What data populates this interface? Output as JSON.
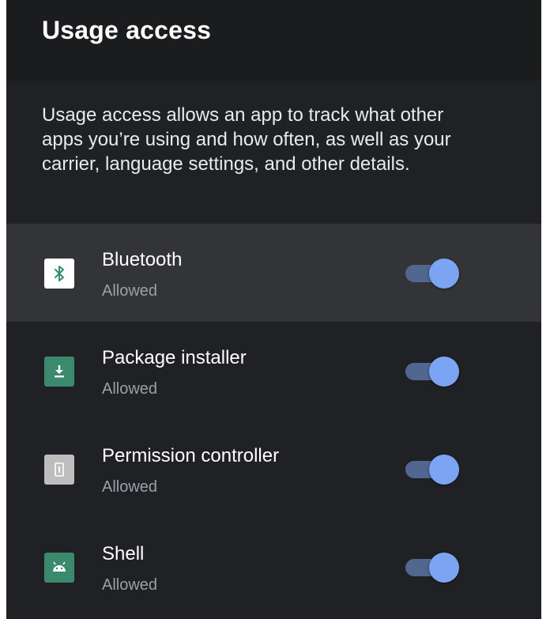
{
  "header": {
    "title": "Usage access"
  },
  "description": "Usage access allows an app to track what other apps you’re using and how often, as well as your carrier, language settings, and other details.",
  "apps": [
    {
      "name": "Bluetooth",
      "status": "Allowed",
      "icon": "bluetooth-icon",
      "icon_bg": "#ffffff",
      "enabled": true,
      "focused": true
    },
    {
      "name": "Package installer",
      "status": "Allowed",
      "icon": "download-icon",
      "icon_bg": "#3b8a6e",
      "enabled": true,
      "focused": false
    },
    {
      "name": "Permission controller",
      "status": "Allowed",
      "icon": "permission-controller-icon",
      "icon_bg": "#bdbdbd",
      "enabled": true,
      "focused": false
    },
    {
      "name": "Shell",
      "status": "Allowed",
      "icon": "android-icon",
      "icon_bg": "#3b8a6e",
      "enabled": true,
      "focused": false
    }
  ],
  "colors": {
    "toggle_track_on": "#51678f",
    "toggle_thumb_on": "#7ba5f2",
    "background": "#202124",
    "focused_row": "#333437"
  }
}
